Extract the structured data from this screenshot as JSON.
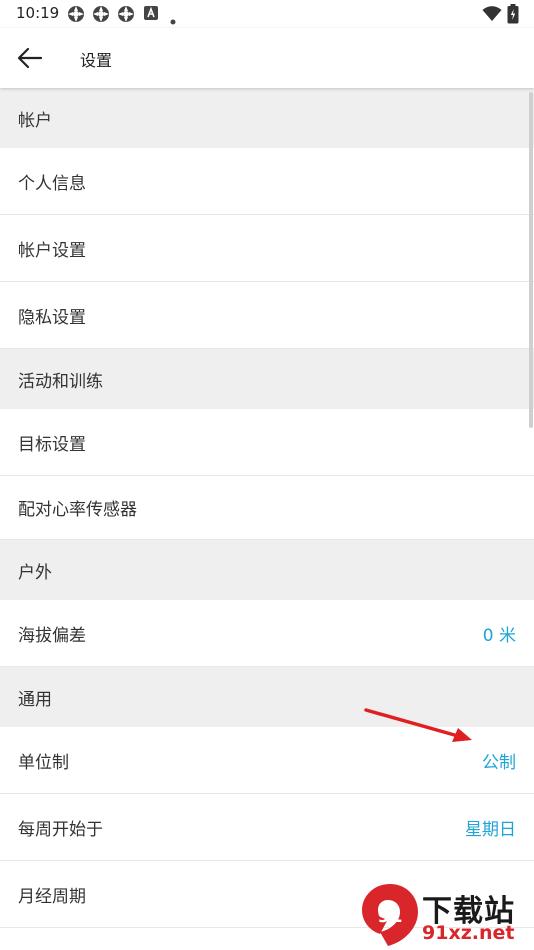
{
  "status_bar": {
    "time": "10:19",
    "left_icons": [
      "app-icon",
      "app-icon",
      "app-icon",
      "a-icon",
      "dot-icon"
    ],
    "right_icons": [
      "wifi-icon",
      "battery-icon"
    ]
  },
  "header": {
    "title": "设置",
    "back_icon": "arrow-left-icon"
  },
  "sections": [
    {
      "title": "帐户",
      "items": [
        {
          "label": "个人信息",
          "value": ""
        },
        {
          "label": "帐户设置",
          "value": ""
        },
        {
          "label": "隐私设置",
          "value": ""
        }
      ]
    },
    {
      "title": "活动和训练",
      "items": [
        {
          "label": "目标设置",
          "value": ""
        },
        {
          "label": "配对心率传感器",
          "value": ""
        }
      ]
    },
    {
      "title": "户外",
      "items": [
        {
          "label": "海拔偏差",
          "value": "0 米"
        }
      ]
    },
    {
      "title": "通用",
      "items": [
        {
          "label": "单位制",
          "value": "公制"
        },
        {
          "label": "每周开始于",
          "value": "星期日"
        },
        {
          "label": "月经周期",
          "value": ""
        }
      ]
    }
  ],
  "colors": {
    "value_accent": "#1fa4d8",
    "section_bg": "#efefef",
    "annotation_arrow": "#e02020"
  },
  "watermark": {
    "title": "下载站",
    "subtitle": "91xz.net"
  }
}
